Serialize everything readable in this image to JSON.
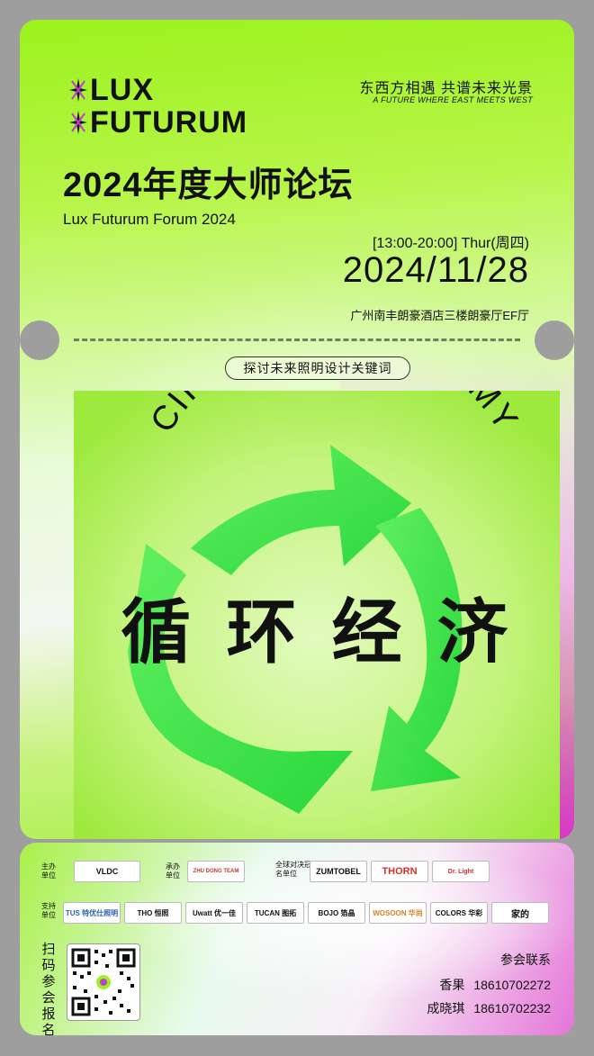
{
  "header": {
    "logo_line1": "LUX",
    "logo_line2": "FUTURUM",
    "title_cn": "2024年度大师论坛",
    "title_en": "Lux Futurum Forum 2024",
    "tagline_cn": "东西方相遇  共谱未来光景",
    "tagline_en": "A FUTURE WHERE EAST MEETS WEST"
  },
  "event": {
    "time": "[13:00-20:00] Thur(周四)",
    "date": "2024/11/28",
    "venue": "广州南丰朗豪酒店三楼朗豪厅EF厅"
  },
  "keyword_pill": "探讨未来照明设计关键词",
  "artwork": {
    "arc_text": "CIRCULAR ECONOMY",
    "title_cn": "循 环 经 济",
    "arrow_color": "#3ae64a"
  },
  "sponsors": {
    "host_label": "主办单位",
    "organizer_label": "承办单位",
    "title_sponsor_label": "全球对决冠名单位",
    "support_label": "支持单位",
    "host_logos": [
      "VLDC"
    ],
    "organizer_logos": [
      "ZHU DONG TEAM"
    ],
    "title_logos": [
      "ZUMTOBEL",
      "THORN",
      "Dr. Light"
    ],
    "support_logos": [
      "TUS 特优仕照明",
      "THO 恒照",
      "Uwatt 优一佳",
      "TUCAN 图拓",
      "BOJO 箔晶",
      "WOSOON 华尚",
      "COLORS 华彩",
      "家的"
    ]
  },
  "registration": {
    "scan_label": "扫码参会报名",
    "contact_title": "参会联系",
    "contacts": [
      {
        "name": "香果",
        "phone": "18610702272"
      },
      {
        "name": "成晓琪",
        "phone": "18610702232"
      }
    ]
  },
  "colors": {
    "lime": "#9cf21d",
    "magenta": "#db2cd0",
    "arrow_green": "#3ae64a",
    "background_gray": "#9e9e9e"
  }
}
